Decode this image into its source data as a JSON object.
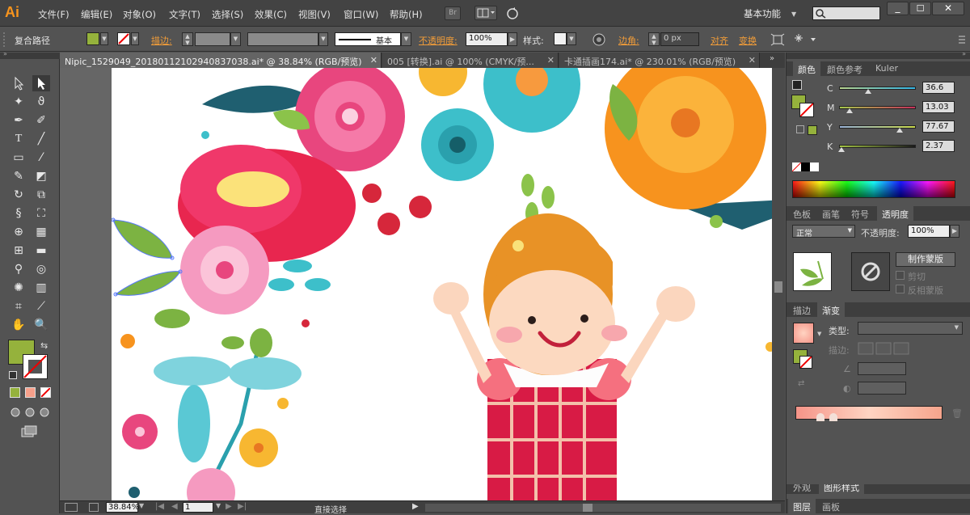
{
  "app": {
    "logo": "Ai",
    "workspace": "基本功能",
    "accent": "#f7941d"
  },
  "menu": [
    "文件(F)",
    "编辑(E)",
    "对象(O)",
    "文字(T)",
    "选择(S)",
    "效果(C)",
    "视图(V)",
    "窗口(W)",
    "帮助(H)"
  ],
  "menu_icons": {
    "bridge": "Br",
    "arrange": "arrange-icon",
    "sync": "sync-icon"
  },
  "control": {
    "selection_label": "复合路径",
    "stroke_label": "描边:",
    "stroke_style": "基本",
    "opacity_label": "不透明度:",
    "opacity_value": "100%",
    "style_label": "样式:",
    "corner_label": "边角:",
    "corner_value": "0 px",
    "align_label": "对齐",
    "transform_label": "变换",
    "fill_color": "#95b23c"
  },
  "tabs": [
    {
      "label": "Nipic_1529049_20180112102940837038.ai* @ 38.84% (RGB/预览)",
      "active": true
    },
    {
      "label": "005 [转换].ai @ 100% (CMYK/预...",
      "active": false
    },
    {
      "label": "卡通插画174.ai* @ 230.01% (RGB/预览)",
      "active": false
    }
  ],
  "status": {
    "zoom": "38.84%",
    "page": "1",
    "tool": "直接选择"
  },
  "color_panel": {
    "tabs": [
      "颜色",
      "颜色参考",
      "Kuler"
    ],
    "channels": [
      {
        "name": "C",
        "value": "36.6",
        "pos": 0.366
      },
      {
        "name": "M",
        "value": "13.03",
        "pos": 0.13
      },
      {
        "name": "Y",
        "value": "77.67",
        "pos": 0.777
      },
      {
        "name": "K",
        "value": "2.37",
        "pos": 0.024
      }
    ]
  },
  "transparency_panel": {
    "tabs": [
      "色板",
      "画笔",
      "符号",
      "透明度"
    ],
    "mode": "正常",
    "opacity_label": "不透明度:",
    "opacity_value": "100%",
    "make_mask": "制作蒙版",
    "clip": "剪切",
    "invert": "反相蒙版"
  },
  "gradient_panel": {
    "tabs": [
      "描边",
      "渐变"
    ],
    "type_label": "类型:",
    "stroke_label": "描边:",
    "bottom_tabs": [
      "外观",
      "图形样式"
    ]
  },
  "layers_panel": {
    "tabs": [
      "图层",
      "画板"
    ]
  }
}
